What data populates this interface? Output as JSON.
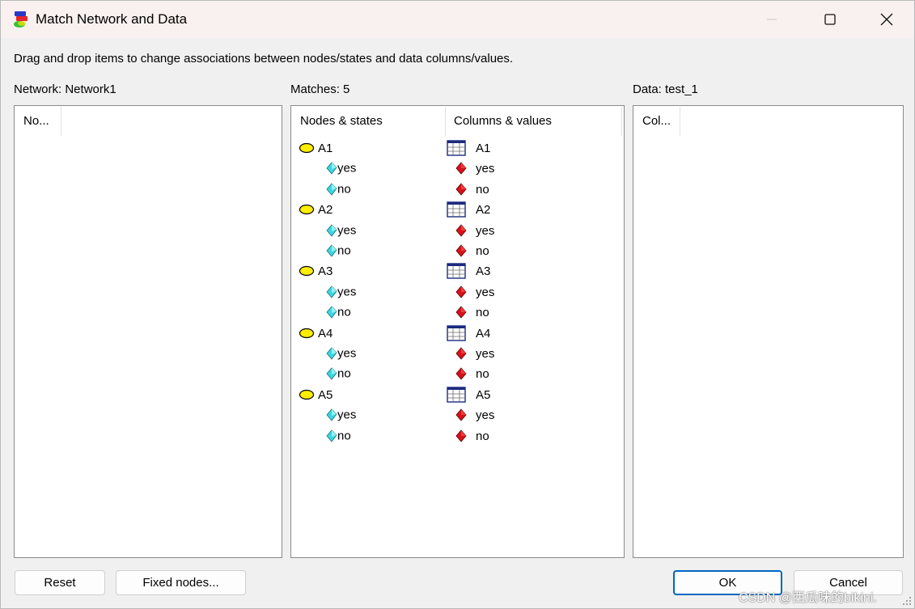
{
  "window": {
    "title": "Match Network and Data",
    "controls": {
      "minimize": "minimize",
      "maximize": "maximize",
      "close": "close"
    }
  },
  "instructions": "Drag and drop items to change associations between nodes/states and data columns/values.",
  "network_panel": {
    "label": "Network: Network1",
    "column_header": "No..."
  },
  "matches_panel": {
    "label": "Matches: 5",
    "column_headers": [
      "Nodes & states",
      "Columns & values"
    ],
    "rows": [
      {
        "kind": "node",
        "left": "A1",
        "right": "A1"
      },
      {
        "kind": "state",
        "left": "yes",
        "right": "yes"
      },
      {
        "kind": "state",
        "left": "no",
        "right": "no"
      },
      {
        "kind": "node",
        "left": "A2",
        "right": "A2"
      },
      {
        "kind": "state",
        "left": "yes",
        "right": "yes"
      },
      {
        "kind": "state",
        "left": "no",
        "right": "no"
      },
      {
        "kind": "node",
        "left": "A3",
        "right": "A3"
      },
      {
        "kind": "state",
        "left": "yes",
        "right": "yes"
      },
      {
        "kind": "state",
        "left": "no",
        "right": "no"
      },
      {
        "kind": "node",
        "left": "A4",
        "right": "A4"
      },
      {
        "kind": "state",
        "left": "yes",
        "right": "yes"
      },
      {
        "kind": "state",
        "left": "no",
        "right": "no"
      },
      {
        "kind": "node",
        "left": "A5",
        "right": "A5"
      },
      {
        "kind": "state",
        "left": "yes",
        "right": "yes"
      },
      {
        "kind": "state",
        "left": "no",
        "right": "no"
      }
    ]
  },
  "data_panel": {
    "label": "Data: test_1",
    "column_header": "Col..."
  },
  "buttons": {
    "reset": "Reset",
    "fixed_nodes": "Fixed nodes...",
    "ok": "OK",
    "cancel": "Cancel"
  },
  "watermark": "CSDN @西瓜味的bikini.",
  "icons": {
    "node": "yellow-ellipse-node-icon",
    "state": "cyan-diamond-state-icon",
    "column": "table-column-icon",
    "value": "red-diamond-value-icon"
  },
  "colors": {
    "node_fill": "#ffee00",
    "state_fill": "#3cd6e0",
    "value_fill": "#d8121a",
    "column_outline": "#1c2a80",
    "default_button_border": "#0067c0",
    "titlebar": "#f9f1ef"
  }
}
